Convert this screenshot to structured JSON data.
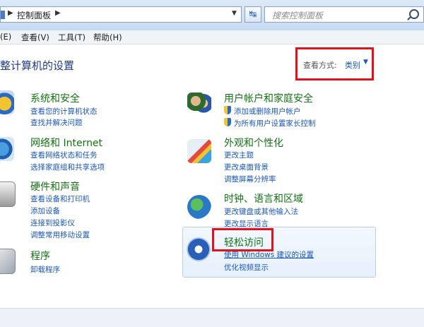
{
  "address_bar": {
    "path_label": "控制面板",
    "search_placeholder": "搜索控制面板"
  },
  "menu": [
    {
      "label": "(E)"
    },
    {
      "label": "查看(V)"
    },
    {
      "label": "工具(T)"
    },
    {
      "label": "帮助(H)"
    }
  ],
  "page_title": "整计算机的设置",
  "view": {
    "label": "查看方式:",
    "value": "类别"
  },
  "categories": {
    "system_security": {
      "title": "系统和安全",
      "links": [
        "查看您的计算机状态",
        "查找并解决问题"
      ]
    },
    "network": {
      "title": "网络和 Internet",
      "links": [
        "查看网络状态和任务",
        "选择家庭组和共享选项"
      ]
    },
    "hardware": {
      "title": "硬件和声音",
      "links": [
        "查看设备和打印机",
        "添加设备",
        "连接到投影仪",
        "调整常用移动设置"
      ]
    },
    "programs": {
      "title": "程序",
      "links": [
        "卸载程序"
      ]
    },
    "user_accounts": {
      "title": "用户帐户和家庭安全",
      "links": [
        "添加或删除用户帐户",
        "为所有用户设置家长控制"
      ]
    },
    "appearance": {
      "title": "外观和个性化",
      "links": [
        "更改主题",
        "更改桌面背景",
        "调整屏幕分辨率"
      ]
    },
    "clock": {
      "title": "时钟、语言和区域",
      "links": [
        "更改键盘或其他输入法",
        "更改显示语言"
      ]
    },
    "ease": {
      "title": "轻松访问",
      "links": [
        "使用 Windows 建议的设置",
        "优化视频显示"
      ]
    }
  },
  "colors": {
    "title_green": "#127312",
    "link_blue": "#1a56c4",
    "highlight_red": "#e0121c"
  }
}
